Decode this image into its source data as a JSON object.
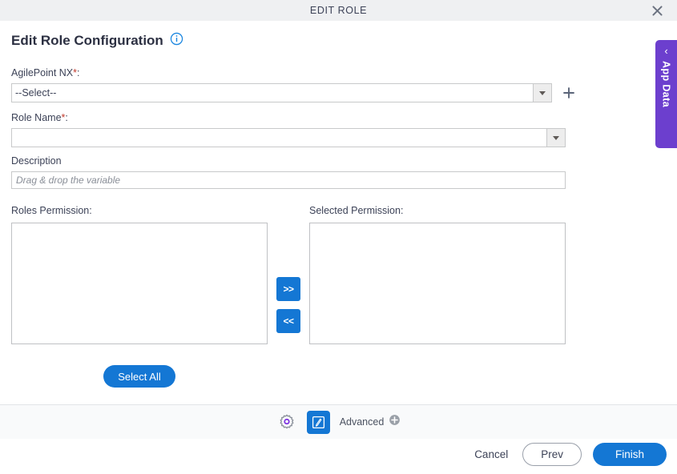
{
  "window": {
    "title": "EDIT ROLE",
    "close_icon": "close-icon"
  },
  "header": {
    "title": "Edit Role Configuration",
    "info_icon": "info-icon"
  },
  "form": {
    "agilepoint": {
      "label": "AgilePoint NX",
      "required_marker": "*",
      "colon": ":",
      "value": "--Select--",
      "dropdown_icon": "chevron-down-icon",
      "add_icon": "plus-icon"
    },
    "role_name": {
      "label": "Role Name",
      "required_marker": "*",
      "colon": ":",
      "value": "",
      "dropdown_icon": "chevron-down-icon"
    },
    "description": {
      "label": "Description",
      "value": "",
      "placeholder": "Drag & drop the variable"
    }
  },
  "permissions": {
    "roles_label": "Roles Permission:",
    "selected_label": "Selected Permission:",
    "roles_items": [],
    "selected_items": [],
    "move_right_label": ">>",
    "move_left_label": "<<",
    "select_all_label": "Select All"
  },
  "toolbar": {
    "gear_icon": "gear-icon",
    "edit_icon": "edit-pencil-icon",
    "advanced_label": "Advanced",
    "advanced_add_icon": "circle-plus-icon"
  },
  "actions": {
    "cancel_label": "Cancel",
    "prev_label": "Prev",
    "finish_label": "Finish"
  },
  "app_data_tab": {
    "label": "App Data",
    "chevron": "‹",
    "color": "#6c3fce"
  },
  "colors": {
    "accent_blue": "#1477d4",
    "purple": "#6c3fce",
    "required_red": "#c0392b",
    "titlebar_bg": "#eff0f2",
    "toolbar_bg": "#f9fafb"
  }
}
